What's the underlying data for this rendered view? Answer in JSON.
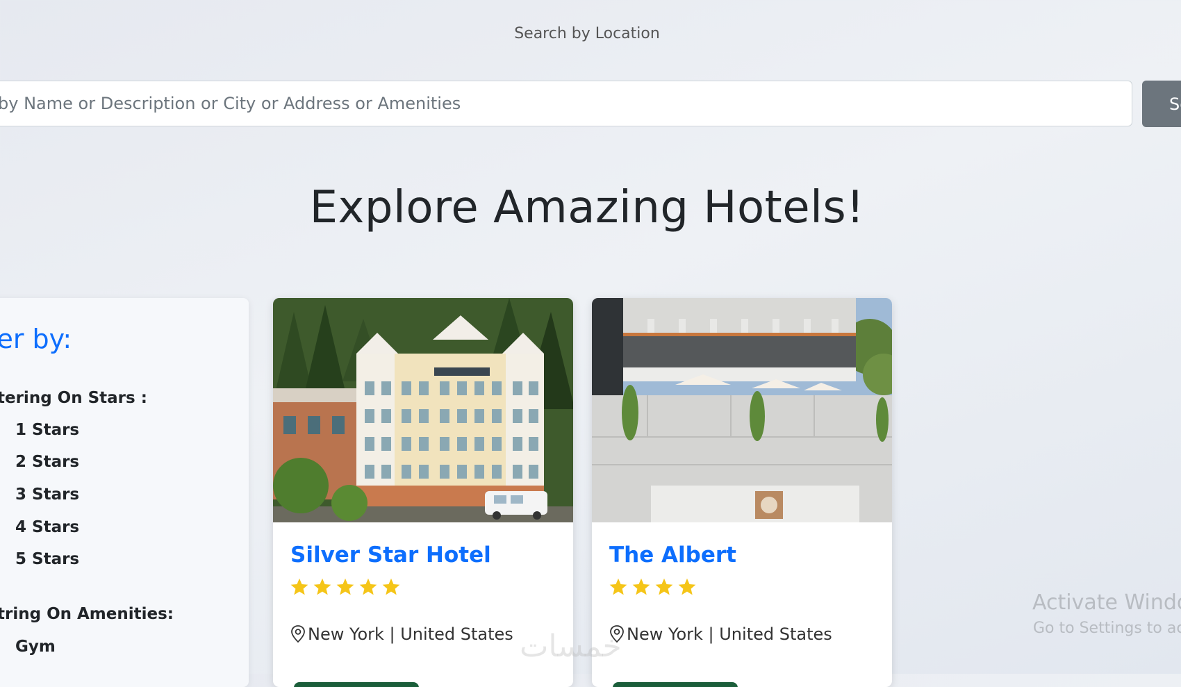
{
  "search": {
    "label": "Search by Location",
    "placeholder": "ch by Name or Description or City or Address or Amenities",
    "button_label": "Sea"
  },
  "page_title": "Explore Amazing Hotels!",
  "filter": {
    "title": "lter by:",
    "stars_heading": "tering On Stars :",
    "star_options": [
      "1 Stars",
      "2 Stars",
      "3 Stars",
      "4 Stars",
      "5 Stars"
    ],
    "amenities_heading": "tring On Amenities:",
    "amenity_options": [
      "Gym"
    ]
  },
  "hotels": [
    {
      "name": "Silver Star Hotel",
      "stars": 5,
      "location": "New York | United States"
    },
    {
      "name": "The Albert",
      "stars": 4,
      "location": "New York | United States"
    }
  ],
  "os_notice": {
    "title": "Activate Windo",
    "subtitle": "Go to Settings to ac"
  },
  "watermark": "خمسات",
  "colors": {
    "accent": "#0d6efd",
    "star": "#f5c518",
    "button": "#6c757d"
  }
}
